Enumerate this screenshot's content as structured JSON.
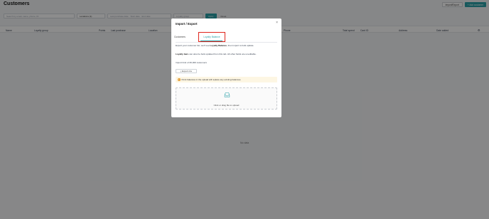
{
  "page": {
    "title": "Customers",
    "import_export_label": "Import/Export",
    "add_customer_label": "+ Add customer",
    "no_data": "No data"
  },
  "filters": {
    "search_placeholder": "Search by email, name, phone, ID",
    "locations": "Locations (1)",
    "date_start": "Last purchase date",
    "date_sep": "Start date",
    "date_end": "End date",
    "loyalty_group": "Loyalty group",
    "apply": "Apply",
    "reset": "Reset"
  },
  "table": {
    "columns": [
      "Name",
      "Loyalty group",
      "Points",
      "Last purchase",
      "Location",
      "Phone",
      "Total spend",
      "Card ID",
      "Address",
      "Date added"
    ]
  },
  "modal": {
    "title": "Import / Export",
    "tabs": [
      {
        "label": "Customers",
        "active": false
      },
      {
        "label": "Loyalty Balance",
        "active": true
      }
    ],
    "line1_prefix": "Export your customer list, we'll see ",
    "line1_bold": "Loyalty Balance",
    "line1_suffix": ", then import to bulk update.",
    "line2_bold": "Loyalty bars",
    "line2_rest": " can also be bulk updated from this tab. All other fields are uneditable.",
    "line3": "Import limit of 30,000 customers",
    "export_label": "Export csv",
    "warning": "Point balances in the upload will replace any existing balances.",
    "upload_text": "Click or drag file to upload"
  },
  "colors": {
    "accent": "#2aa0a8",
    "highlight": "#e0241b",
    "warning_bg": "#fdf6e3"
  }
}
